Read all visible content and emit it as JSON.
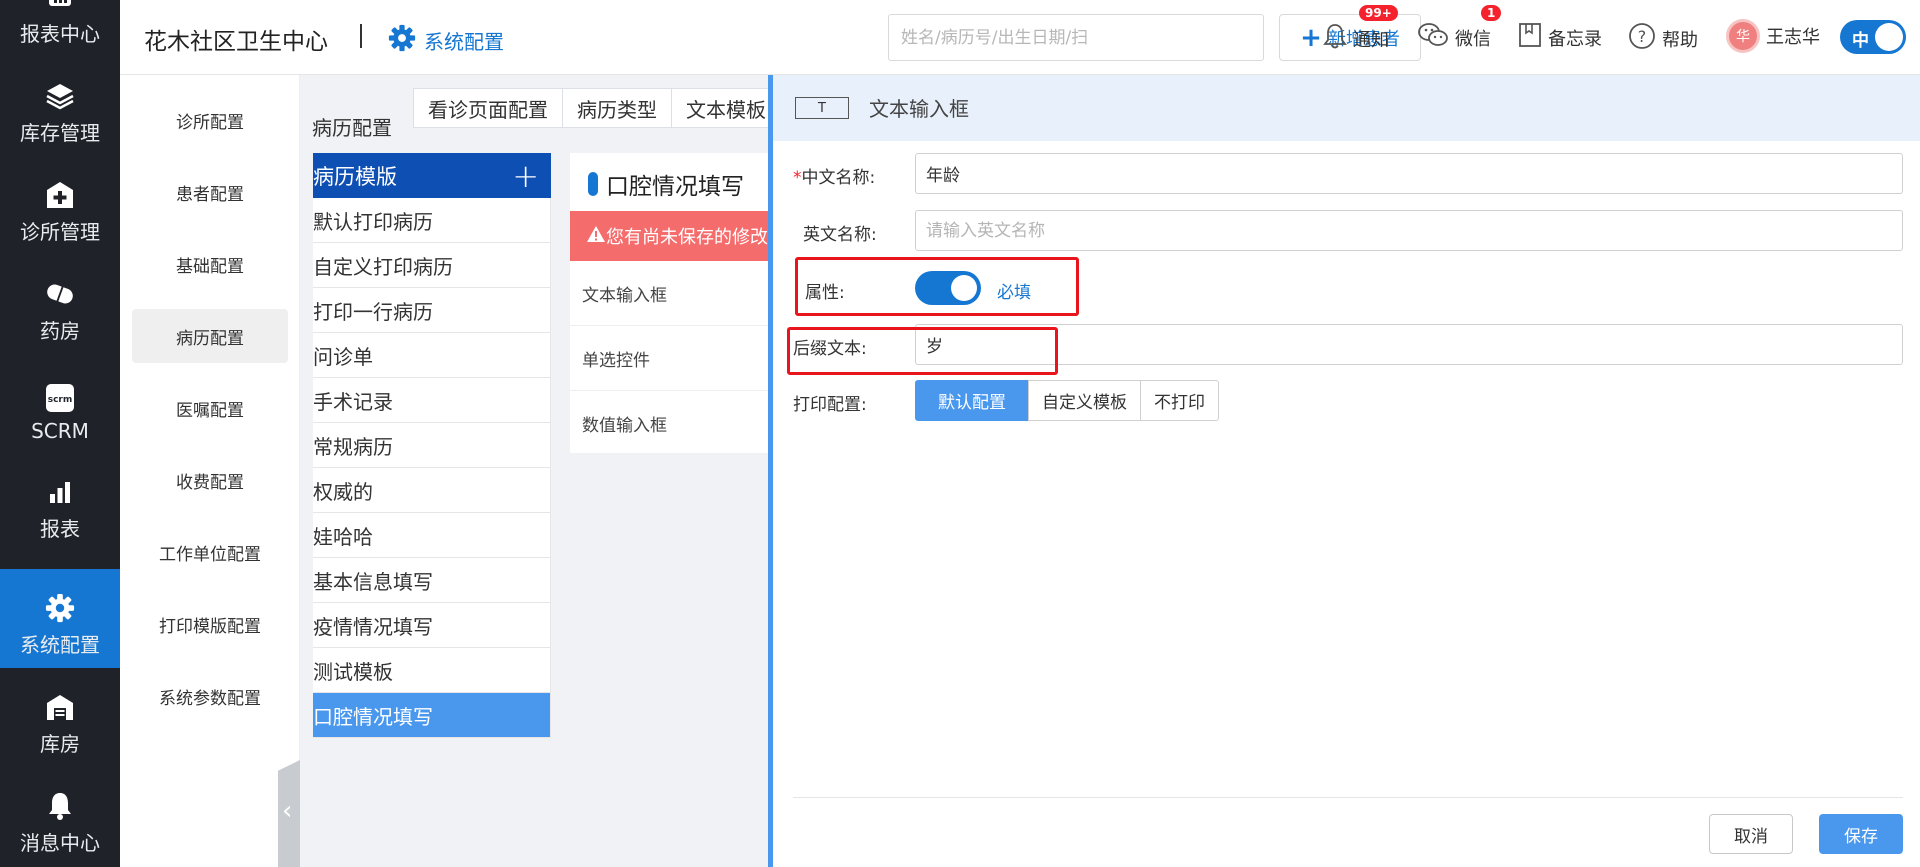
{
  "nav": [
    {
      "label": "报表中心",
      "icon": "report-center-icon"
    },
    {
      "label": "库存管理",
      "icon": "layers-icon"
    },
    {
      "label": "诊所管理",
      "icon": "clinic-plus-icon"
    },
    {
      "label": "药房",
      "icon": "pill-icon"
    },
    {
      "label": "SCRM",
      "icon": "scrm-icon"
    },
    {
      "label": "报表",
      "icon": "bar-chart-icon"
    },
    {
      "label": "系统配置",
      "icon": "gear-icon",
      "active": true
    },
    {
      "label": "库房",
      "icon": "warehouse-icon"
    },
    {
      "label": "消息中心",
      "icon": "bell-icon"
    }
  ],
  "header": {
    "clinic_name": "花木社区卫生中心",
    "section": "系统配置",
    "search_placeholder": "姓名/病历号/出生日期/扫",
    "add_patient": "新增患者",
    "notify": {
      "label": "通知",
      "badge": "99+"
    },
    "wechat": {
      "label": "微信",
      "badge": "1"
    },
    "memo": "备忘录",
    "help": "帮助",
    "user_avatar": "华",
    "user_name": "王志华",
    "lang": "中"
  },
  "config_menu": [
    {
      "label": "诊所配置"
    },
    {
      "label": "患者配置"
    },
    {
      "label": "基础配置"
    },
    {
      "label": "病历配置",
      "active": true
    },
    {
      "label": "医嘱配置"
    },
    {
      "label": "收费配置"
    },
    {
      "label": "工作单位配置"
    },
    {
      "label": "打印模版配置"
    },
    {
      "label": "系统参数配置"
    }
  ],
  "page_title": "病历配置",
  "top_tabs": [
    "看诊页面配置",
    "病历类型",
    "文本模板"
  ],
  "template_list": {
    "header": "病历模版",
    "items": [
      "默认打印病历",
      "自定义打印病历",
      "打印一行病历",
      "问诊单",
      "手术记录",
      "常规病历",
      "权威的",
      "娃哈哈",
      "基本信息填写",
      "疫情情况填写",
      "测试模板",
      "口腔情况填写"
    ],
    "active_index": 11
  },
  "mid_panel": {
    "title": "口腔情况填写",
    "warning": "您有尚未保存的修改",
    "controls": [
      "文本输入框",
      "单选控件",
      "数值输入框"
    ]
  },
  "drawer": {
    "icon_text": "T",
    "title": "文本输入框",
    "fields": {
      "cn_name_label": "中文名称:",
      "cn_name_value": "年龄",
      "en_name_label": "英文名称:",
      "en_name_placeholder": "请输入英文名称",
      "attr_label": "属性:",
      "attr_toggle_on": true,
      "attr_required": "必填",
      "suffix_label": "后缀文本:",
      "suffix_value": "岁",
      "print_label": "打印配置:",
      "print_options": [
        "默认配置",
        "自定义模板",
        "不打印"
      ],
      "print_selected": 0
    },
    "cancel": "取消",
    "save": "保存"
  },
  "colors": {
    "accent": "#1677d2",
    "nav_bg": "#1f2329",
    "warn": "#f56c6c",
    "highlight": "#e8161c"
  }
}
